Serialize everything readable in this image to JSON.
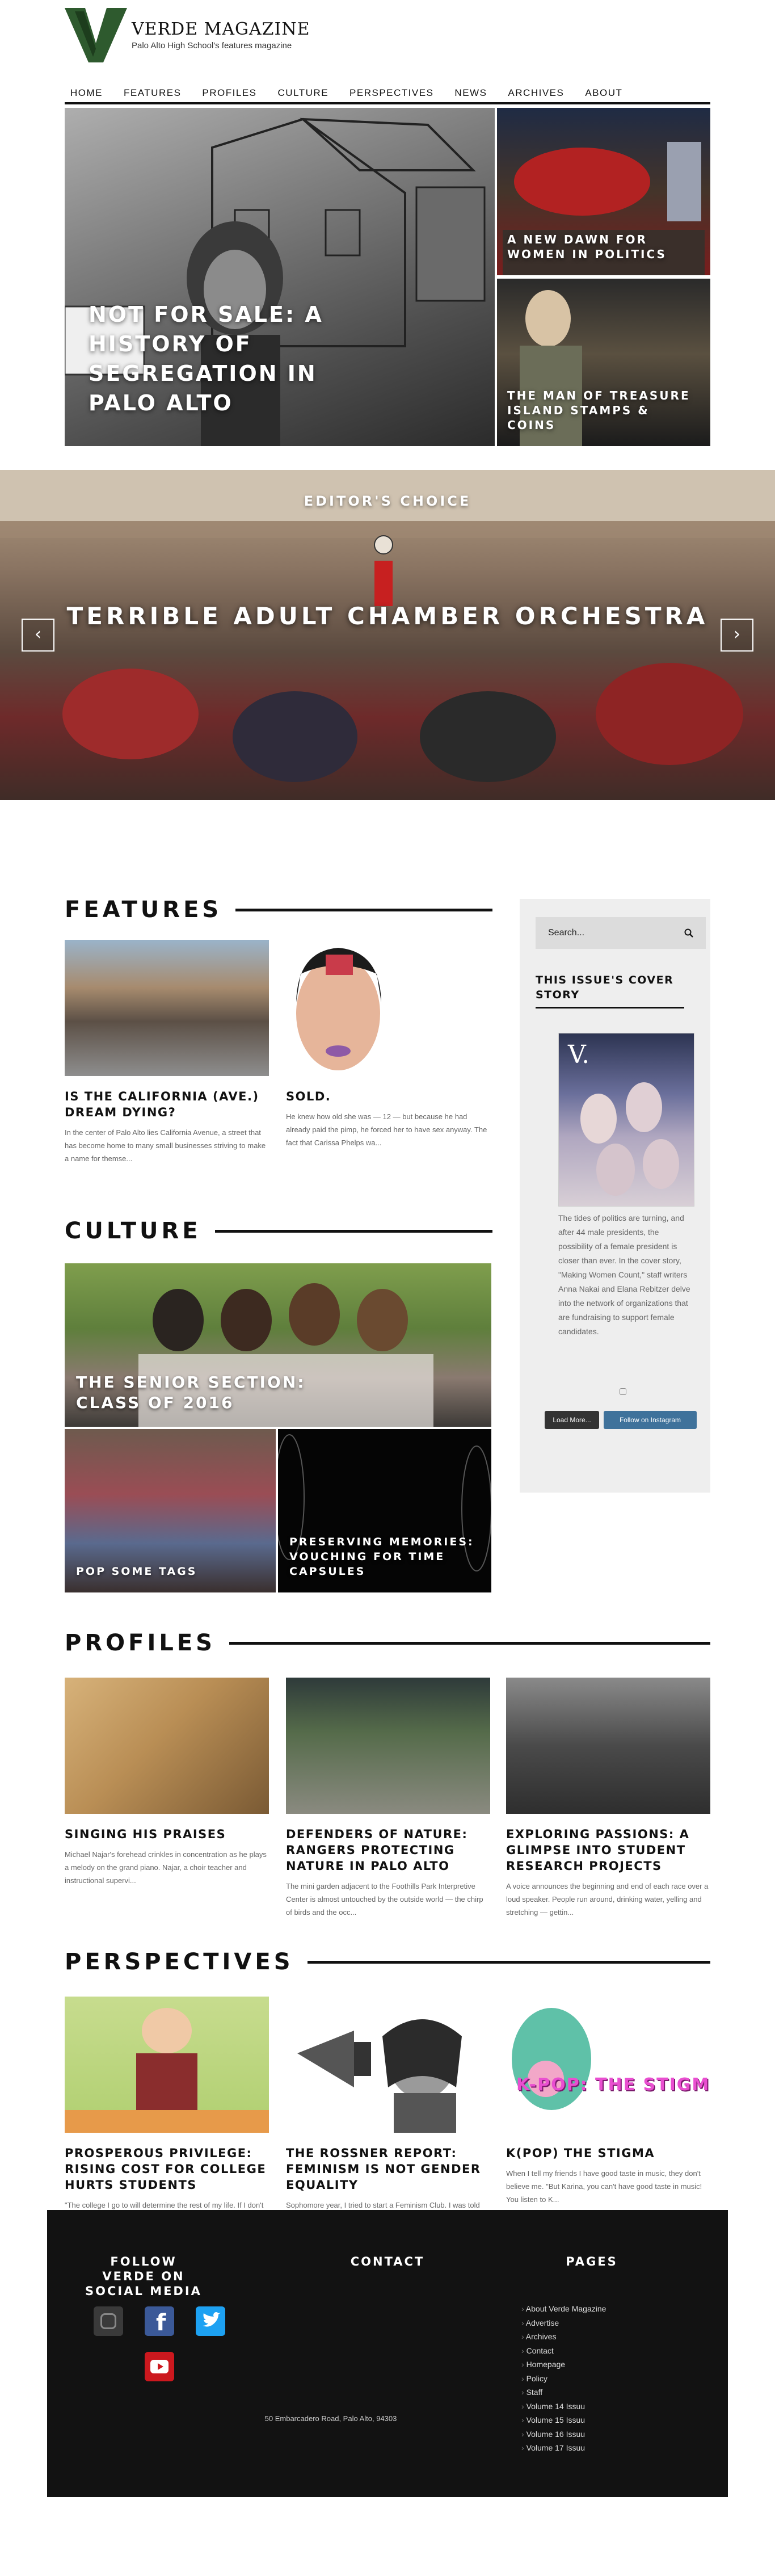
{
  "site": {
    "title": "VERDE MAGAZINE",
    "subtitle": "Palo Alto High School's features magazine",
    "logo_letter": "V",
    "brand_color": "#2e5a2e"
  },
  "nav": [
    "HOME",
    "FEATURES",
    "PROFILES",
    "CULTURE",
    "PERSPECTIVES",
    "NEWS",
    "ARCHIVES",
    "ABOUT"
  ],
  "hero": {
    "main": "NOT FOR SALE: A HISTORY OF SEGREGATION IN PALO ALTO",
    "side1": "A NEW DAWN FOR WOMEN IN POLITICS",
    "side2": "THE MAN OF TREASURE ISLAND STAMPS & COINS"
  },
  "editors_choice": {
    "label": "EDITOR'S CHOICE",
    "title": "TERRIBLE ADULT CHAMBER ORCHESTRA",
    "prev_icon": "chevron-left-icon",
    "next_icon": "chevron-right-icon"
  },
  "features": {
    "heading": "FEATURES",
    "cards": [
      {
        "title": "IS THE CALIFORNIA (AVE.) DREAM DYING?",
        "excerpt": "In the center of Palo Alto lies California Avenue, a street that has become home to many small businesses striving to make a name for themse..."
      },
      {
        "title": "SOLD.",
        "excerpt": "He knew how old she was — 12 — but because he had already paid the pimp, he forced her to have sex anyway. The fact that Carissa Phelps wa..."
      }
    ]
  },
  "culture": {
    "heading": "CULTURE",
    "main": "THE SENIOR SECTION: CLASS OF 2016",
    "tile1": "POP SOME TAGS",
    "tile2": "PRESERVING MEMORIES: VOUCHING FOR TIME CAPSULES"
  },
  "profiles": {
    "heading": "PROFILES",
    "cards": [
      {
        "title": "SINGING HIS PRAISES",
        "excerpt": "Michael Najar's forehead crinkles in concentration as he plays a melody on the grand piano. Najar, a choir teacher and instructional supervi..."
      },
      {
        "title": "DEFENDERS OF NATURE: RANGERS PROTECTING NATURE IN PALO ALTO",
        "excerpt": "The mini garden adjacent to the Foothills Park Interpretive Center is almost untouched by the outside world — the chirp of birds and the occ..."
      },
      {
        "title": "EXPLORING PASSIONS: A GLIMPSE INTO STUDENT RESEARCH PROJECTS",
        "excerpt": "A voice announces the beginning and end of each race over a loud speaker. People run around, drinking water, yelling and stretching — gettin..."
      }
    ]
  },
  "perspectives": {
    "heading": "PERSPECTIVES",
    "cards": [
      {
        "title": "PROSPEROUS PRIVILEGE: RISING COST FOR COLLEGE HURTS STUDENTS",
        "excerpt": "\"The college I go to will determine the rest of my life. If I don't get into my dream school, then I am a failure and will die alone.\" This ..."
      },
      {
        "title": "THE ROSSNER REPORT: FEMINISM IS NOT GENDER EQUALITY",
        "excerpt": "Sophomore year, I tried to start a Feminism Club. I was told that the word 'feminism' was too controversial, and to just call it Gender Equa..."
      },
      {
        "title": "K(POP) THE STIGMA",
        "excerpt": "When I tell my friends I have good taste in music, they don't believe me. \"But Karina, you can't have good taste in music! You listen to K..."
      }
    ],
    "kpop_image_text": "K-POP: THE STIGMA"
  },
  "sidebar": {
    "search_placeholder": "Search...",
    "search_icon": "search-icon",
    "cover_title": "THIS ISSUE'S COVER STORY",
    "cover_letter": "V.",
    "cover_text": "The tides of politics are turning, and after 44 male presidents, the possibility of a female president is closer than ever. In the cover story, \"Making Women Count,\" staff writers Anna Nakai and Elana Rebitzer delve into the network of organizations that are fundraising to support female candidates.",
    "load_more": "Load More...",
    "follow_instagram": "Follow on Instagram"
  },
  "footer": {
    "social_heading": "FOLLOW VERDE ON SOCIAL MEDIA",
    "contact_heading": "CONTACT",
    "pages_heading": "PAGES",
    "address": "50 Embarcadero Road, Palo Alto, 94303",
    "pages": [
      "About Verde Magazine",
      "Advertise",
      "Archives",
      "Contact",
      "Homepage",
      "Policy",
      "Staff",
      "Volume 14 Issuu",
      "Volume 15 Issuu",
      "Volume 16 Issuu",
      "Volume 17 Issuu"
    ],
    "social_icons": [
      "instagram-icon",
      "facebook-icon",
      "twitter-icon",
      "youtube-icon"
    ]
  }
}
